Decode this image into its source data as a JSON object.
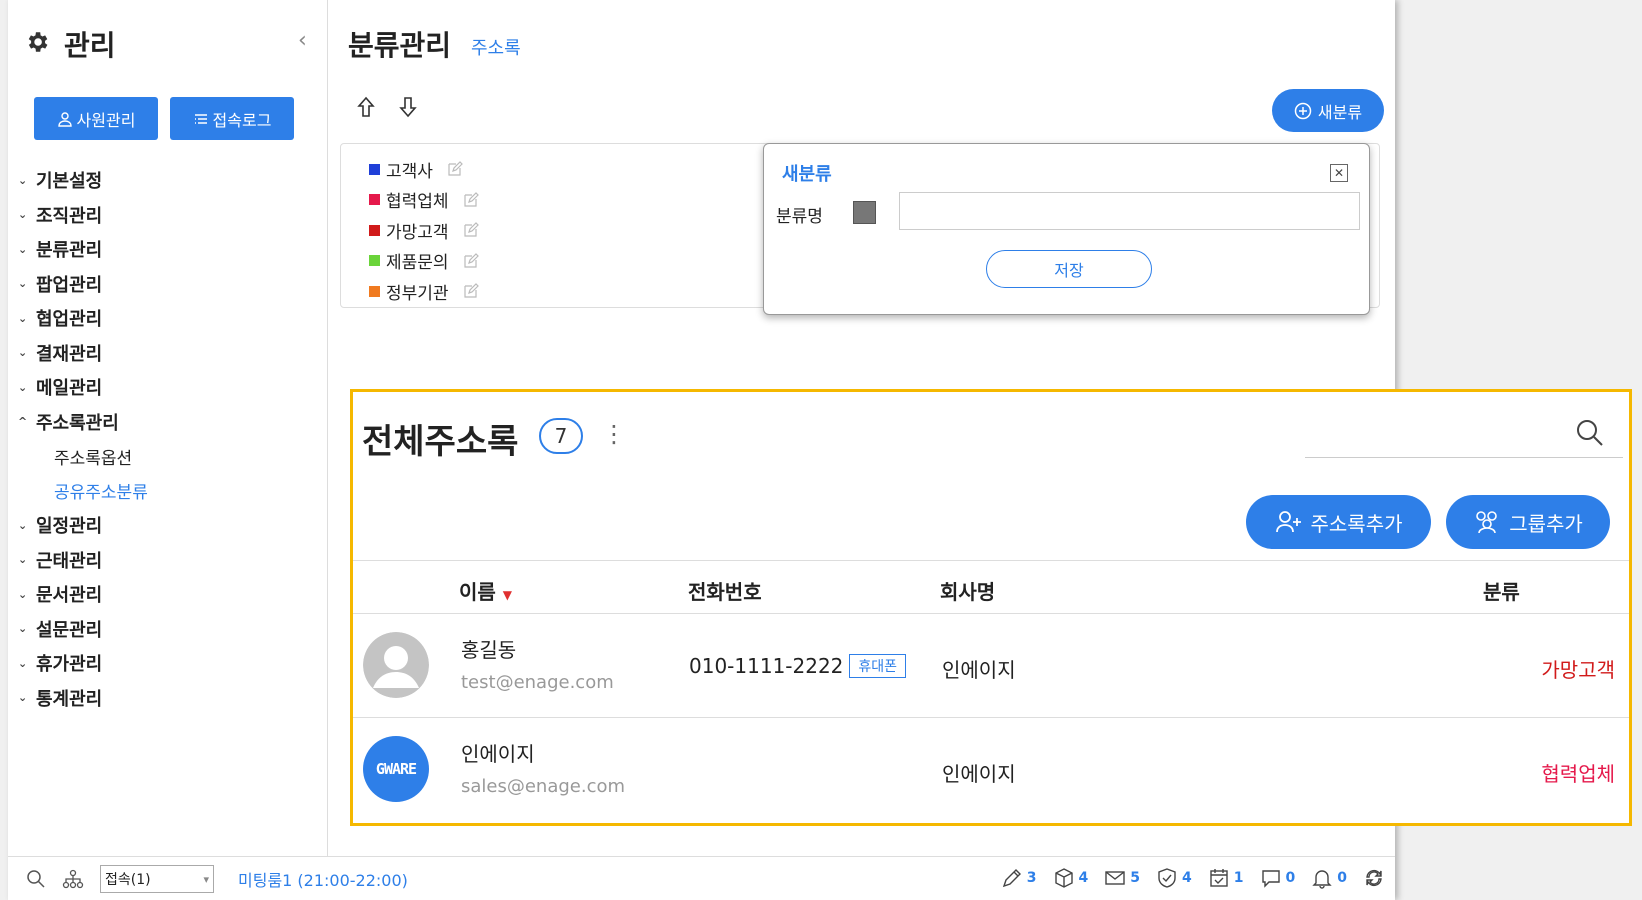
{
  "sidebar": {
    "title": "관리",
    "buttons": {
      "staff": "사원관리",
      "log": "접속로그"
    },
    "menu": [
      {
        "label": "기본설정",
        "chev": "⌄"
      },
      {
        "label": "조직관리",
        "chev": "⌄"
      },
      {
        "label": "분류관리",
        "chev": "⌄"
      },
      {
        "label": "팝업관리",
        "chev": "⌄"
      },
      {
        "label": "협업관리",
        "chev": "⌄"
      },
      {
        "label": "결재관리",
        "chev": "⌄"
      },
      {
        "label": "메일관리",
        "chev": "⌄"
      },
      {
        "label": "주소록관리",
        "chev": "^"
      },
      {
        "label": "주소록옵션"
      },
      {
        "label": "공유주소분류"
      },
      {
        "label": "일정관리",
        "chev": "⌄"
      },
      {
        "label": "근태관리",
        "chev": "⌄"
      },
      {
        "label": "문서관리",
        "chev": "⌄"
      },
      {
        "label": "설문관리",
        "chev": "⌄"
      },
      {
        "label": "휴가관리",
        "chev": "⌄"
      },
      {
        "label": "통계관리",
        "chev": "⌄"
      }
    ]
  },
  "header": {
    "title": "분류관리",
    "subtitle": "주소록",
    "new_button": "새분류"
  },
  "categories": [
    {
      "label": "고객사",
      "color": "#1f3fd8"
    },
    {
      "label": "협력업체",
      "color": "#e5194b"
    },
    {
      "label": "가망고객",
      "color": "#d11a1a"
    },
    {
      "label": "제품문의",
      "color": "#6ad43a"
    },
    {
      "label": "정부기관",
      "color": "#f07a1f"
    }
  ],
  "popup": {
    "title": "새분류",
    "field_label": "분류명",
    "swatch_color": "#777777",
    "input_value": "",
    "save_label": "저장"
  },
  "address_book": {
    "title": "전체주소록",
    "count": "7",
    "add_button": "주소록추가",
    "group_button": "그룹추가",
    "columns": {
      "name": "이름",
      "phone": "전화번호",
      "company": "회사명",
      "category": "분류"
    },
    "rows": [
      {
        "name": "홍길동",
        "email": "test@enage.com",
        "phone": "010-1111-2222",
        "phone_tag": "휴대폰",
        "company": "인에이지",
        "category": "가망고객",
        "category_color": "#d11a1a"
      },
      {
        "name": "인에이지",
        "email": "sales@enage.com",
        "phone": "",
        "phone_tag": "",
        "company": "인에이지",
        "category": "협력업체",
        "category_color": "#e5194b",
        "avatar_text": "GWARE"
      }
    ]
  },
  "statusbar": {
    "select_value": "접속(1)",
    "meeting": "미팅룸1 (21:00-22:00)",
    "counters": [
      {
        "icon": "pen-icon",
        "value": "3"
      },
      {
        "icon": "box-icon",
        "value": "4"
      },
      {
        "icon": "mail-icon",
        "value": "5"
      },
      {
        "icon": "shield-check-icon",
        "value": "4"
      },
      {
        "icon": "calendar-icon",
        "value": "1"
      },
      {
        "icon": "chat-icon",
        "value": "0"
      },
      {
        "icon": "bell-icon",
        "value": "0"
      }
    ]
  }
}
